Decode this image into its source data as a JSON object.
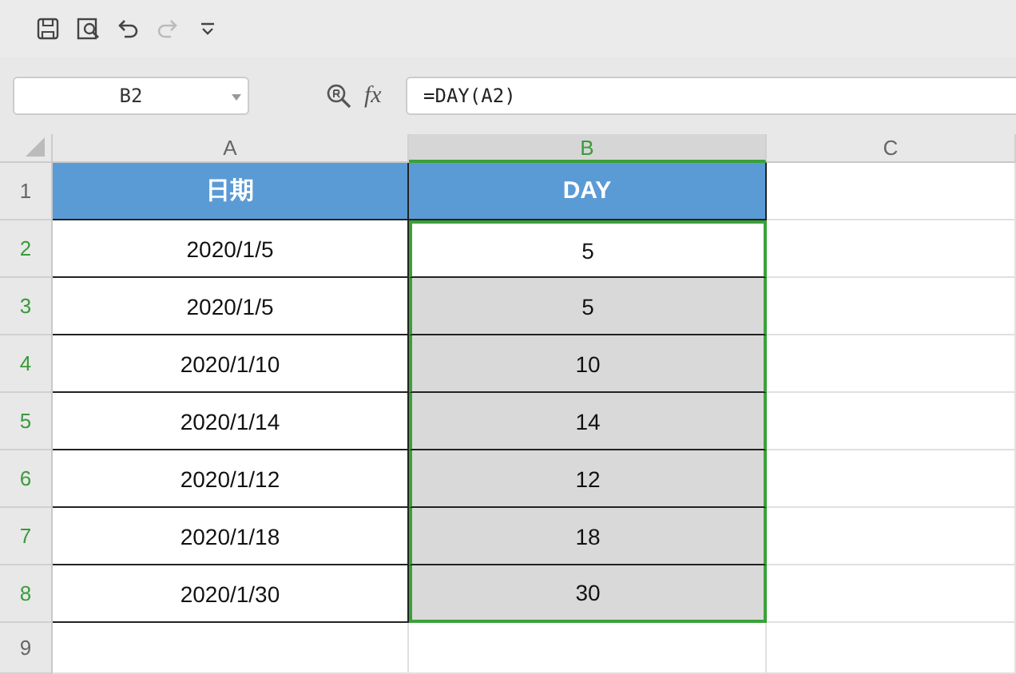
{
  "toolbar": {
    "redo_disabled": true
  },
  "name_box": {
    "value": "B2"
  },
  "formula_bar": {
    "label": "fx",
    "value": "=DAY(A2)"
  },
  "columns": [
    {
      "label": "A",
      "selected": false
    },
    {
      "label": "B",
      "selected": true
    },
    {
      "label": "C",
      "selected": false
    }
  ],
  "rows": [
    {
      "number": "1",
      "selected": false,
      "active": false,
      "kind": "header",
      "cells": [
        "日期",
        "DAY"
      ]
    },
    {
      "number": "2",
      "selected": true,
      "active": true,
      "kind": "data",
      "cells": [
        "2020/1/5",
        "5"
      ]
    },
    {
      "number": "3",
      "selected": true,
      "active": false,
      "kind": "data",
      "cells": [
        "2020/1/5",
        "5"
      ]
    },
    {
      "number": "4",
      "selected": true,
      "active": false,
      "kind": "data",
      "cells": [
        "2020/1/10",
        "10"
      ]
    },
    {
      "number": "5",
      "selected": true,
      "active": false,
      "kind": "data",
      "cells": [
        "2020/1/14",
        "14"
      ]
    },
    {
      "number": "6",
      "selected": true,
      "active": false,
      "kind": "data",
      "cells": [
        "2020/1/12",
        "12"
      ]
    },
    {
      "number": "7",
      "selected": true,
      "active": false,
      "kind": "data",
      "cells": [
        "2020/1/18",
        "18"
      ]
    },
    {
      "number": "8",
      "selected": true,
      "active": false,
      "kind": "data",
      "cells": [
        "2020/1/30",
        "30"
      ]
    },
    {
      "number": "9",
      "selected": false,
      "active": false,
      "cells": []
    }
  ]
}
